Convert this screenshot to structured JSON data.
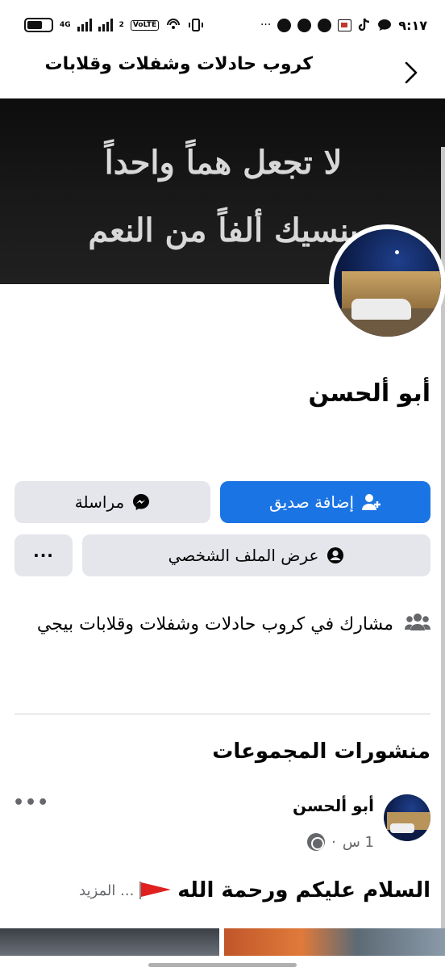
{
  "status_bar": {
    "time": "٩:١٧",
    "ellipsis": "···",
    "network_4g": "4G",
    "sim2": "2",
    "volte": "VoLTE"
  },
  "header": {
    "title": "كروب حادلات وشفلات وقلابات"
  },
  "cover": {
    "line1": "لا تجعل هماً واحداً",
    "line2": "ينسيك ألفاً من النعم"
  },
  "profile": {
    "name": "أبو ألحسن"
  },
  "actions": {
    "add_friend": "إضافة صديق",
    "message": "مراسلة",
    "view_profile": "عرض الملف الشخصي",
    "more": "···"
  },
  "info": {
    "member_of": "مشارك في كروب حادلات وشفلات وقلابات بيجي"
  },
  "group_posts": {
    "section_title": "منشورات المجموعات",
    "post": {
      "author": "أبو ألحسن",
      "time": "1 س",
      "separator": "·",
      "text": "السلام عليكم ورحمة الله",
      "see_more": "... المزيد",
      "menu": "•••"
    }
  },
  "colors": {
    "primary": "#1b74e4",
    "secondary_bg": "#e4e6eb",
    "text": "#050505",
    "muted": "#65676b",
    "divider": "#ced0d4"
  }
}
